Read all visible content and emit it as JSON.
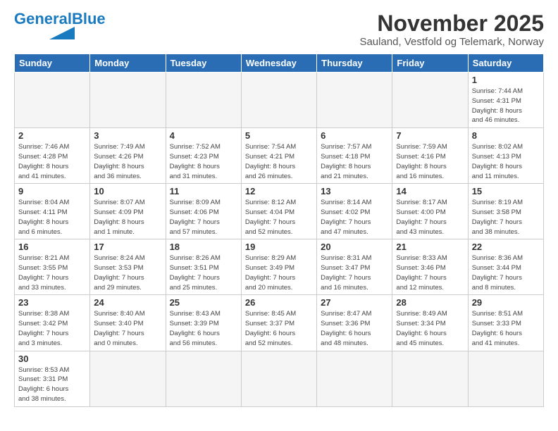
{
  "header": {
    "logo_general": "General",
    "logo_blue": "Blue",
    "title": "November 2025",
    "subtitle": "Sauland, Vestfold og Telemark, Norway"
  },
  "weekdays": [
    "Sunday",
    "Monday",
    "Tuesday",
    "Wednesday",
    "Thursday",
    "Friday",
    "Saturday"
  ],
  "weeks": [
    [
      {
        "day": "",
        "info": ""
      },
      {
        "day": "",
        "info": ""
      },
      {
        "day": "",
        "info": ""
      },
      {
        "day": "",
        "info": ""
      },
      {
        "day": "",
        "info": ""
      },
      {
        "day": "",
        "info": ""
      },
      {
        "day": "1",
        "info": "Sunrise: 7:44 AM\nSunset: 4:31 PM\nDaylight: 8 hours\nand 46 minutes."
      }
    ],
    [
      {
        "day": "2",
        "info": "Sunrise: 7:46 AM\nSunset: 4:28 PM\nDaylight: 8 hours\nand 41 minutes."
      },
      {
        "day": "3",
        "info": "Sunrise: 7:49 AM\nSunset: 4:26 PM\nDaylight: 8 hours\nand 36 minutes."
      },
      {
        "day": "4",
        "info": "Sunrise: 7:52 AM\nSunset: 4:23 PM\nDaylight: 8 hours\nand 31 minutes."
      },
      {
        "day": "5",
        "info": "Sunrise: 7:54 AM\nSunset: 4:21 PM\nDaylight: 8 hours\nand 26 minutes."
      },
      {
        "day": "6",
        "info": "Sunrise: 7:57 AM\nSunset: 4:18 PM\nDaylight: 8 hours\nand 21 minutes."
      },
      {
        "day": "7",
        "info": "Sunrise: 7:59 AM\nSunset: 4:16 PM\nDaylight: 8 hours\nand 16 minutes."
      },
      {
        "day": "8",
        "info": "Sunrise: 8:02 AM\nSunset: 4:13 PM\nDaylight: 8 hours\nand 11 minutes."
      }
    ],
    [
      {
        "day": "9",
        "info": "Sunrise: 8:04 AM\nSunset: 4:11 PM\nDaylight: 8 hours\nand 6 minutes."
      },
      {
        "day": "10",
        "info": "Sunrise: 8:07 AM\nSunset: 4:09 PM\nDaylight: 8 hours\nand 1 minute."
      },
      {
        "day": "11",
        "info": "Sunrise: 8:09 AM\nSunset: 4:06 PM\nDaylight: 7 hours\nand 57 minutes."
      },
      {
        "day": "12",
        "info": "Sunrise: 8:12 AM\nSunset: 4:04 PM\nDaylight: 7 hours\nand 52 minutes."
      },
      {
        "day": "13",
        "info": "Sunrise: 8:14 AM\nSunset: 4:02 PM\nDaylight: 7 hours\nand 47 minutes."
      },
      {
        "day": "14",
        "info": "Sunrise: 8:17 AM\nSunset: 4:00 PM\nDaylight: 7 hours\nand 43 minutes."
      },
      {
        "day": "15",
        "info": "Sunrise: 8:19 AM\nSunset: 3:58 PM\nDaylight: 7 hours\nand 38 minutes."
      }
    ],
    [
      {
        "day": "16",
        "info": "Sunrise: 8:21 AM\nSunset: 3:55 PM\nDaylight: 7 hours\nand 33 minutes."
      },
      {
        "day": "17",
        "info": "Sunrise: 8:24 AM\nSunset: 3:53 PM\nDaylight: 7 hours\nand 29 minutes."
      },
      {
        "day": "18",
        "info": "Sunrise: 8:26 AM\nSunset: 3:51 PM\nDaylight: 7 hours\nand 25 minutes."
      },
      {
        "day": "19",
        "info": "Sunrise: 8:29 AM\nSunset: 3:49 PM\nDaylight: 7 hours\nand 20 minutes."
      },
      {
        "day": "20",
        "info": "Sunrise: 8:31 AM\nSunset: 3:47 PM\nDaylight: 7 hours\nand 16 minutes."
      },
      {
        "day": "21",
        "info": "Sunrise: 8:33 AM\nSunset: 3:46 PM\nDaylight: 7 hours\nand 12 minutes."
      },
      {
        "day": "22",
        "info": "Sunrise: 8:36 AM\nSunset: 3:44 PM\nDaylight: 7 hours\nand 8 minutes."
      }
    ],
    [
      {
        "day": "23",
        "info": "Sunrise: 8:38 AM\nSunset: 3:42 PM\nDaylight: 7 hours\nand 3 minutes."
      },
      {
        "day": "24",
        "info": "Sunrise: 8:40 AM\nSunset: 3:40 PM\nDaylight: 7 hours\nand 0 minutes."
      },
      {
        "day": "25",
        "info": "Sunrise: 8:43 AM\nSunset: 3:39 PM\nDaylight: 6 hours\nand 56 minutes."
      },
      {
        "day": "26",
        "info": "Sunrise: 8:45 AM\nSunset: 3:37 PM\nDaylight: 6 hours\nand 52 minutes."
      },
      {
        "day": "27",
        "info": "Sunrise: 8:47 AM\nSunset: 3:36 PM\nDaylight: 6 hours\nand 48 minutes."
      },
      {
        "day": "28",
        "info": "Sunrise: 8:49 AM\nSunset: 3:34 PM\nDaylight: 6 hours\nand 45 minutes."
      },
      {
        "day": "29",
        "info": "Sunrise: 8:51 AM\nSunset: 3:33 PM\nDaylight: 6 hours\nand 41 minutes."
      }
    ],
    [
      {
        "day": "30",
        "info": "Sunrise: 8:53 AM\nSunset: 3:31 PM\nDaylight: 6 hours\nand 38 minutes."
      },
      {
        "day": "",
        "info": ""
      },
      {
        "day": "",
        "info": ""
      },
      {
        "day": "",
        "info": ""
      },
      {
        "day": "",
        "info": ""
      },
      {
        "day": "",
        "info": ""
      },
      {
        "day": "",
        "info": ""
      }
    ]
  ]
}
